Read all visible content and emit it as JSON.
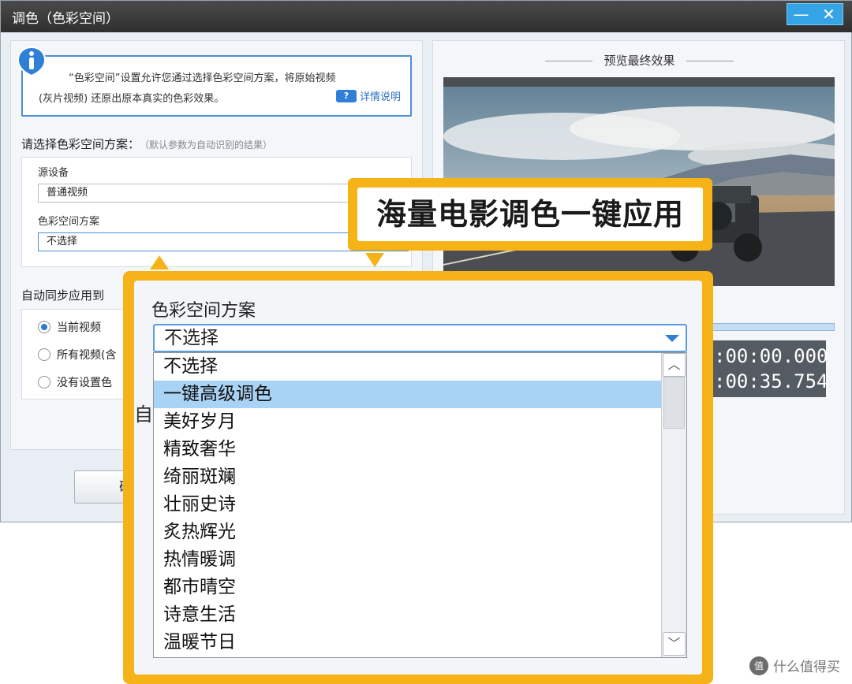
{
  "window": {
    "title": "调色（色彩空间）",
    "minimize_label": "—",
    "close_label": "✕"
  },
  "info": {
    "line1": "“色彩空间”设置允许您通过选择色彩空间方案，将原始视频",
    "line2": "(灰片视频) 还原出原本真实的色彩效果。",
    "detail_link": "详情说明"
  },
  "scheme_section": {
    "label": "请选择色彩空间方案：",
    "hint": "（默认参数为自动识别的结果）",
    "source_device_label": "源设备",
    "source_device_value": "普通视频",
    "color_scheme_label": "色彩空间方案",
    "color_scheme_value": "不选择"
  },
  "sync_section": {
    "label": "自动同步应用到",
    "options": [
      {
        "label": "当前视频",
        "checked": true
      },
      {
        "label": "所有视频(含",
        "checked": false
      },
      {
        "label": "没有设置色",
        "checked": false
      }
    ]
  },
  "ok_button": "确",
  "preview": {
    "title": "预览最终效果",
    "time_current": ":00:00.000",
    "time_total": ":00:35.754"
  },
  "callout": {
    "text": "海量电影调色一键应用",
    "accent_color": "#f5b318"
  },
  "zoom": {
    "label": "色彩空间方案",
    "selected_value": "不选择",
    "behind_text": "自z",
    "items": [
      {
        "label": "不选择",
        "selected": false
      },
      {
        "label": "一键高级调色",
        "selected": true
      },
      {
        "label": "美好岁月",
        "selected": false
      },
      {
        "label": "精致奢华",
        "selected": false
      },
      {
        "label": "绮丽斑斓",
        "selected": false
      },
      {
        "label": "壮丽史诗",
        "selected": false
      },
      {
        "label": "炙热辉光",
        "selected": false
      },
      {
        "label": "热情暖调",
        "selected": false
      },
      {
        "label": "都市晴空",
        "selected": false
      },
      {
        "label": "诗意生活",
        "selected": false
      },
      {
        "label": "温暖节日",
        "selected": false
      }
    ]
  },
  "watermark": {
    "icon": "值",
    "text": "什么值得买"
  }
}
